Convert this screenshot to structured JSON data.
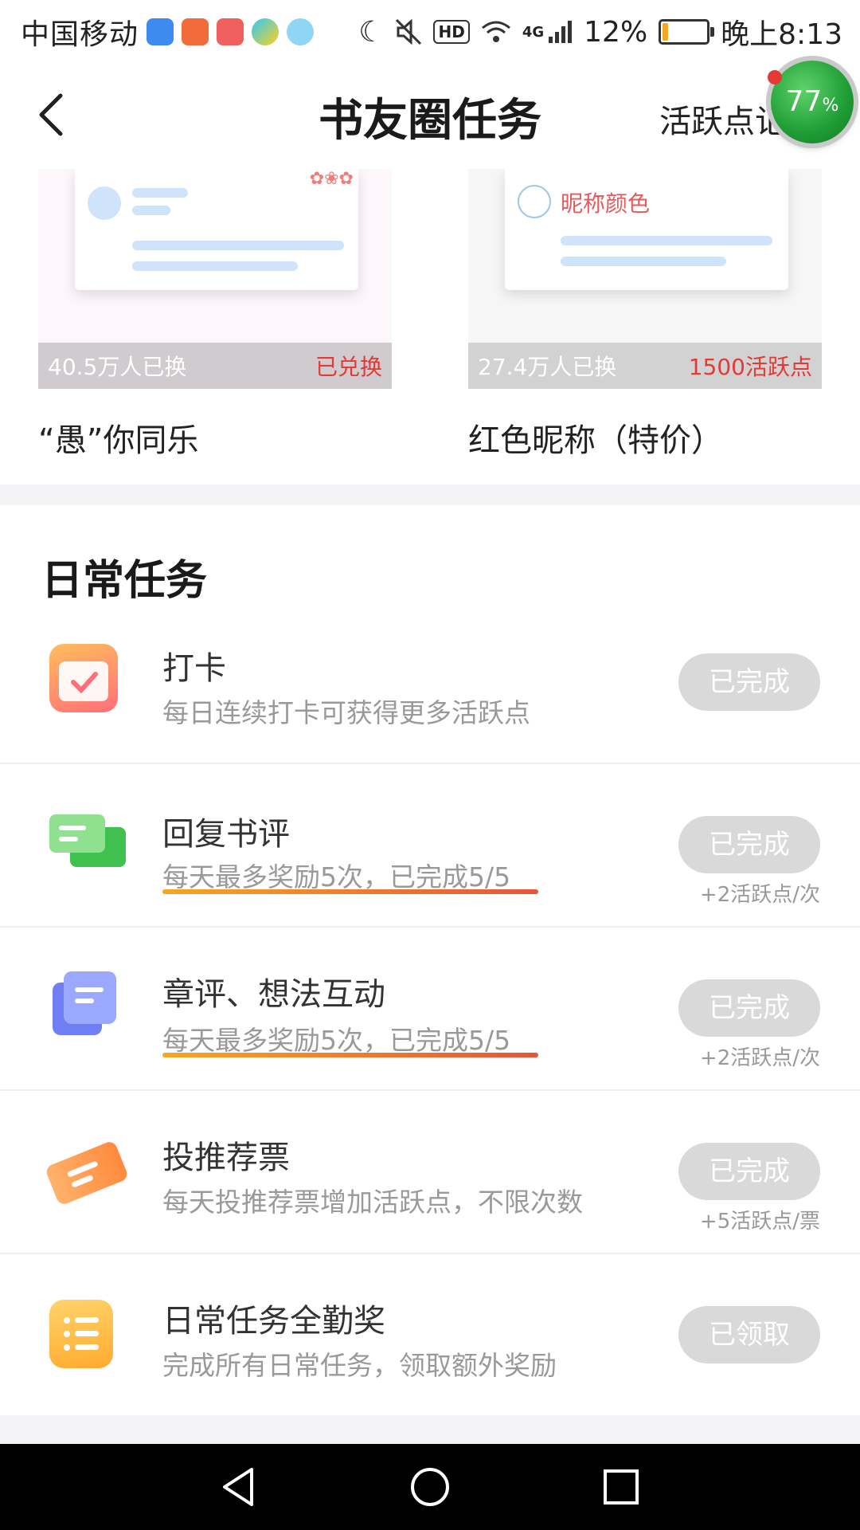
{
  "status_bar": {
    "carrier": "中国移动",
    "network": "4G",
    "battery_percent": "12%",
    "battery_level": 0.12,
    "time": "晚上8:13"
  },
  "header": {
    "title": "书友圈任务",
    "right_link": "活跃点记",
    "bubble_value": "77",
    "bubble_unit": "%"
  },
  "exchange_cards": [
    {
      "count": "40.5万人已换",
      "status": "已兑换",
      "title": "“愚”你同乐"
    },
    {
      "count": "27.4万人已换",
      "status": "1500活跃点",
      "title": "红色昵称（特价）",
      "preview_name": "昵称颜色"
    }
  ],
  "daily": {
    "section_title": "日常任务",
    "tasks": [
      {
        "name": "打卡",
        "desc": "每日连续打卡可获得更多活跃点",
        "button": "已完成",
        "reward": "",
        "icon": "calendar-check-icon"
      },
      {
        "name": "回复书评",
        "desc": "每天最多奖励5次，已完成5/5",
        "button": "已完成",
        "reward": "+2活跃点/次",
        "icon": "chat-bubbles-icon"
      },
      {
        "name": "章评、想法互动",
        "desc": "每天最多奖励5次，已完成5/5",
        "button": "已完成",
        "reward": "+2活跃点/次",
        "icon": "document-stack-icon"
      },
      {
        "name": "投推荐票",
        "desc": "每天投推荐票增加活跃点，不限次数",
        "button": "已完成",
        "reward": "+5活跃点/票",
        "icon": "ticket-icon"
      },
      {
        "name": "日常任务全勤奖",
        "desc": "完成所有日常任务，领取额外奖励",
        "button": "已领取",
        "reward": "",
        "icon": "list-icon"
      }
    ]
  }
}
